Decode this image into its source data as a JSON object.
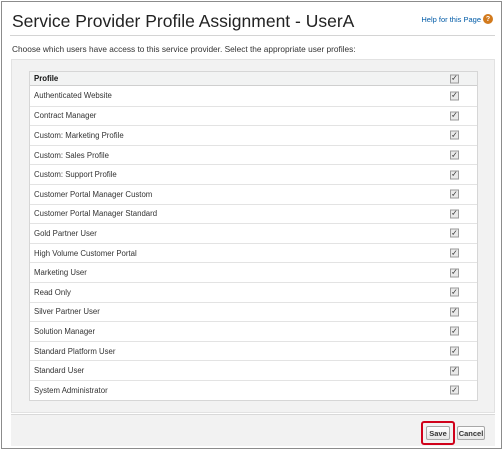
{
  "header": {
    "title": "Service Provider Profile Assignment - UserA",
    "help_label": "Help for this Page",
    "help_icon": "question-mark-icon"
  },
  "description": "Choose which users have access to this service provider. Select the appropriate user profiles:",
  "table": {
    "column_header": "Profile",
    "select_all_checked": true,
    "rows": [
      {
        "label": "Authenticated Website",
        "checked": true
      },
      {
        "label": "Contract Manager",
        "checked": true
      },
      {
        "label": "Custom: Marketing Profile",
        "checked": true
      },
      {
        "label": "Custom: Sales Profile",
        "checked": true
      },
      {
        "label": "Custom: Support Profile",
        "checked": true
      },
      {
        "label": "Customer Portal Manager Custom",
        "checked": true
      },
      {
        "label": "Customer Portal Manager Standard",
        "checked": true
      },
      {
        "label": "Gold Partner User",
        "checked": true
      },
      {
        "label": "High Volume Customer Portal",
        "checked": true
      },
      {
        "label": "Marketing User",
        "checked": true
      },
      {
        "label": "Read Only",
        "checked": true
      },
      {
        "label": "Silver Partner User",
        "checked": true
      },
      {
        "label": "Solution Manager",
        "checked": true
      },
      {
        "label": "Standard Platform User",
        "checked": true
      },
      {
        "label": "Standard User",
        "checked": true
      },
      {
        "label": "System Administrator",
        "checked": true
      }
    ]
  },
  "footer": {
    "save_label": "Save",
    "cancel_label": "Cancel",
    "highlight_color": "#d0021b"
  },
  "colors": {
    "link": "#015ba7",
    "help_icon": "#d27a1d"
  }
}
